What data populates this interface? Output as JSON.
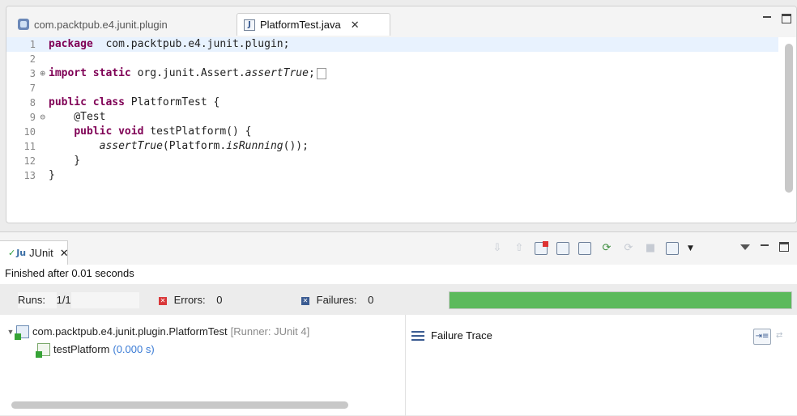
{
  "editor": {
    "tabs": [
      {
        "label": "com.packtpub.e4.junit.plugin",
        "icon": "plugin-icon"
      },
      {
        "label": "PlatformTest.java",
        "icon": "java-file-icon"
      }
    ],
    "code_lines": [
      {
        "n": "1",
        "parts": [
          [
            "kw",
            "package"
          ],
          [
            "",
            "  com.packtpub.e4.junit.plugin;"
          ]
        ]
      },
      {
        "n": "2",
        "parts": []
      },
      {
        "n": "3",
        "fold": "⊕",
        "parts": [
          [
            "kw",
            "import"
          ],
          [
            "",
            " "
          ],
          [
            "kw",
            "static"
          ],
          [
            "",
            " org.junit.Assert."
          ],
          [
            "it",
            "assertTrue"
          ],
          [
            "",
            ";"
          ]
        ]
      },
      {
        "n": "7",
        "parts": []
      },
      {
        "n": "8",
        "parts": [
          [
            "kw",
            "public"
          ],
          [
            "",
            " "
          ],
          [
            "kw",
            "class"
          ],
          [
            "",
            " PlatformTest {"
          ]
        ]
      },
      {
        "n": "9",
        "fold": "⊖",
        "parts": [
          [
            "",
            "    @Test"
          ]
        ]
      },
      {
        "n": "10",
        "parts": [
          [
            "",
            "    "
          ],
          [
            "kw",
            "public"
          ],
          [
            "",
            " "
          ],
          [
            "kw",
            "void"
          ],
          [
            "",
            " testPlatform() {"
          ]
        ]
      },
      {
        "n": "11",
        "parts": [
          [
            "",
            "        "
          ],
          [
            "it",
            "assertTrue"
          ],
          [
            "",
            "(Platform."
          ],
          [
            "it",
            "isRunning"
          ],
          [
            "",
            "());"
          ]
        ]
      },
      {
        "n": "12",
        "parts": [
          [
            "",
            "    }"
          ]
        ]
      },
      {
        "n": "13",
        "parts": [
          [
            "",
            "}"
          ]
        ]
      }
    ]
  },
  "junit": {
    "tab_label": "JUnit",
    "status": "Finished after 0.01 seconds",
    "runs_label": "Runs:",
    "runs_value": "1/1",
    "errors_label": "Errors:",
    "errors_value": "0",
    "failures_label": "Failures:",
    "failures_value": "0",
    "progress": 1.0,
    "progress_color": "#5cba5c",
    "tree": {
      "suite_name": "com.packtpub.e4.junit.plugin.PlatformTest",
      "suite_runner": "[Runner: JUnit 4]",
      "test_name": "testPlatform",
      "test_time": "(0.000 s)"
    },
    "trace_label": "Failure Trace"
  }
}
